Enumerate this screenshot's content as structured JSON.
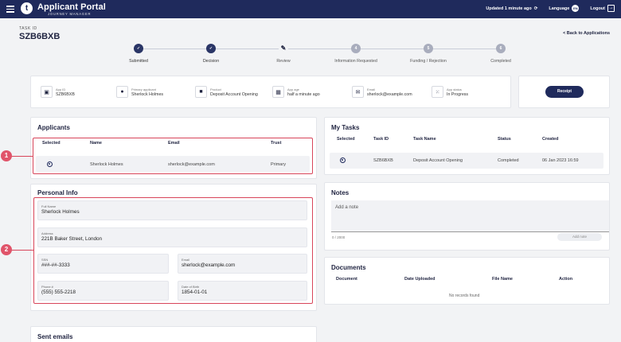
{
  "header": {
    "brand_initial": "t",
    "brand_title": "Applicant Portal",
    "brand_subtitle": "JOURNEY MANAGER",
    "updated": "Updated 1 minute ago",
    "language": "Language",
    "language_code": "EN",
    "logout": "Logout"
  },
  "task": {
    "label": "TASK ID",
    "id": "SZB6BXB",
    "back": "< Back to Applications"
  },
  "stepper": [
    {
      "label": "Submitted",
      "state": "done",
      "mark": "✓"
    },
    {
      "label": "Decision",
      "state": "done",
      "mark": "✓"
    },
    {
      "label": "Review",
      "state": "current",
      "mark": "✎"
    },
    {
      "label": "Information Requested",
      "state": "pending",
      "mark": "4"
    },
    {
      "label": "Funding / Rejection",
      "state": "pending",
      "mark": "5"
    },
    {
      "label": "Completed",
      "state": "pending",
      "mark": "6"
    }
  ],
  "info": {
    "app_id_label": "App ID",
    "app_id": "SZB6BXB",
    "primary_label": "Primary applicant",
    "primary": "Sherlock Holmes",
    "product_label": "Product",
    "product": "Deposit Account Opening",
    "age_label": "App age",
    "age": "half a minute ago",
    "email_label": "Email",
    "email": "sherlock@example.com",
    "status_label": "App status",
    "status": "In Progress",
    "receipt": "Receipt"
  },
  "applicants": {
    "title": "Applicants",
    "headers": {
      "selected": "Selected",
      "name": "Name",
      "email": "Email",
      "trust": "Trust"
    },
    "row": {
      "name": "Sherlock Holmes",
      "email": "sherlock@example.com",
      "trust": "Primary"
    }
  },
  "personal": {
    "title": "Personal Info",
    "full_name_label": "Full Name",
    "full_name": "Sherlock Holmes",
    "address_label": "Address",
    "address": "221B Baker Street, London",
    "ssn_label": "SSN",
    "ssn": "###-##-3333",
    "email_label": "Email",
    "email": "sherlock@example.com",
    "phone_label": "Phone #",
    "phone": "(555) 555-2218",
    "dob_label": "Date of Birth",
    "dob": "1854-01-01"
  },
  "sent_emails": {
    "title": "Sent emails"
  },
  "tasks": {
    "title": "My Tasks",
    "headers": {
      "selected": "Selected",
      "task_id": "Task ID",
      "task_name": "Task Name",
      "status": "Status",
      "created": "Created"
    },
    "row": {
      "task_id": "SZB6BXB",
      "task_name": "Deposit Account Opening",
      "status": "Completed",
      "created": "06 Jan 2023 16:59"
    }
  },
  "notes": {
    "title": "Notes",
    "placeholder": "Add a note",
    "counter": "0 / 2000",
    "add": "Add note"
  },
  "documents": {
    "title": "Documents",
    "headers": {
      "document": "Document",
      "date": "Date Uploaded",
      "file": "File Name",
      "action": "Action"
    },
    "empty": "No records found"
  },
  "annotations": {
    "one": "1",
    "two": "2"
  },
  "colors": {
    "navy": "#1f2a5c",
    "highlight": "#d8455a"
  }
}
